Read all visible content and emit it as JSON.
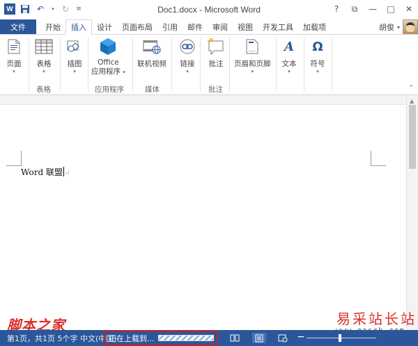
{
  "window": {
    "title": "Doc1.docx - Microsoft Word",
    "controls": {
      "help": "?",
      "restore": "⧉",
      "minimize": "—",
      "maximize": "□",
      "close": "✕"
    }
  },
  "qat": {
    "app_icon_letter": "W",
    "undo": "↶",
    "redo": "↻"
  },
  "tabs": {
    "file": "文件",
    "items": [
      {
        "label": "开始",
        "active": false
      },
      {
        "label": "插入",
        "active": true
      },
      {
        "label": "设计",
        "active": false
      },
      {
        "label": "页面布局",
        "active": false
      },
      {
        "label": "引用",
        "active": false
      },
      {
        "label": "邮件",
        "active": false
      },
      {
        "label": "审阅",
        "active": false
      },
      {
        "label": "视图",
        "active": false
      },
      {
        "label": "开发工具",
        "active": false
      },
      {
        "label": "加载项",
        "active": false
      }
    ],
    "user": "胡俊"
  },
  "ribbon": {
    "pages_btn": "页面",
    "table_btn": "表格",
    "table_group": "表格",
    "illus_btn": "插图",
    "office_line1": "Office",
    "office_line2": "应用程序",
    "apps_group": "应用程序",
    "video_btn": "联机视频",
    "media_group": "媒体",
    "link_btn": "链接",
    "comment_btn": "批注",
    "comment_group": "批注",
    "header_btn": "页眉和页脚",
    "text_btn": "文本",
    "symbol_btn": "符号",
    "symbol_glyph": "Ω",
    "text_glyph": "A"
  },
  "document": {
    "text": "Word 联盟",
    "para_mark": "↵"
  },
  "statusbar": {
    "left_text": "第1页，共1页  5个字  中文(中国)",
    "upload_text": "正在上载到..."
  },
  "watermark": {
    "left": "脚本之家",
    "right": "易采站长站",
    "url": "www.easck.com"
  },
  "colors": {
    "accent": "#2b579a",
    "highlight": "#d21e1e"
  }
}
